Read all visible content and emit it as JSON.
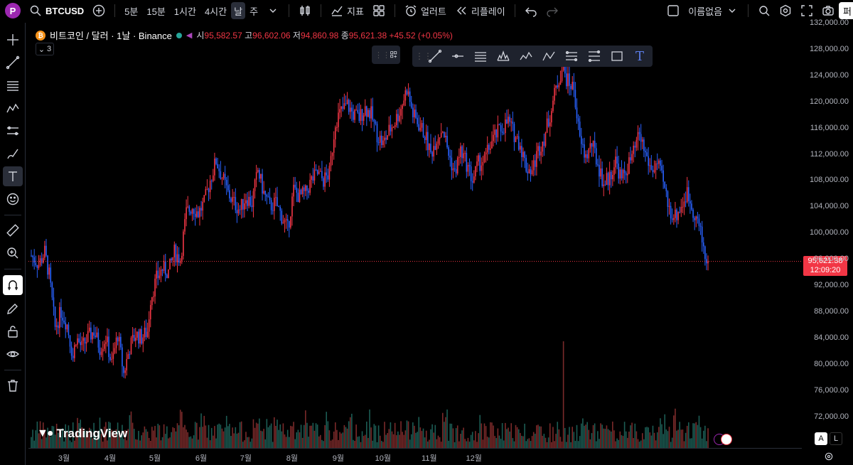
{
  "toolbar": {
    "avatar_letter": "P",
    "symbol": "BTCUSD",
    "intervals": [
      "5분",
      "15분",
      "1시간",
      "4시간",
      "날",
      "주"
    ],
    "active_interval": "날",
    "indicators_label": "지표",
    "alert_label": "얼러트",
    "replay_label": "리플레이",
    "layout_name": "이름없음",
    "cut_label": "퍼"
  },
  "legend": {
    "name": "비트코인 / 달러 · 1날 · Binance",
    "open_label": "시",
    "open": "95,582.57",
    "high_label": "고",
    "high": "96,602.06",
    "low_label": "저",
    "low": "94,860.98",
    "close_label": "종",
    "close": "95,621.38",
    "change": "+45.52 (+0.05%)",
    "collapse_count": "3"
  },
  "watermark": "TradingView",
  "price_tag": {
    "price": "95,621.38",
    "countdown": "12:09:20"
  },
  "bottom_right": {
    "auto_label": "A",
    "log_label": "L"
  },
  "colors": {
    "up": "#f23645",
    "down": "#2962ff",
    "vol_up": "#7a2a2a",
    "vol_down": "#1c5c54",
    "accent": "#2962ff"
  },
  "chart_data": {
    "type": "candlestick",
    "ylim": [
      70000,
      132000
    ],
    "price_ticks": [
      "132,000.00",
      "128,000.00",
      "124,000.00",
      "120,000.00",
      "116,000.00",
      "112,000.00",
      "108,000.00",
      "104,000.00",
      "100,000.00",
      "96,000.00",
      "92,000.00",
      "88,000.00",
      "84,000.00",
      "80,000.00",
      "76,000.00",
      "72,000.00"
    ],
    "months": [
      "3월",
      "4월",
      "5월",
      "6월",
      "7월",
      "8월",
      "9월",
      "10월",
      "11월",
      "12월"
    ],
    "last_price": 95621.38,
    "close_path": [
      [
        0,
        96500
      ],
      [
        5,
        95200
      ],
      [
        9,
        97000
      ],
      [
        12,
        93500
      ],
      [
        16,
        85500
      ],
      [
        20,
        88000
      ],
      [
        24,
        86000
      ],
      [
        28,
        81000
      ],
      [
        30,
        84000
      ],
      [
        34,
        82500
      ],
      [
        38,
        84000
      ],
      [
        42,
        85000
      ],
      [
        46,
        82500
      ],
      [
        50,
        84000
      ],
      [
        54,
        80000
      ],
      [
        58,
        84500
      ],
      [
        62,
        78500
      ],
      [
        66,
        82500
      ],
      [
        70,
        84500
      ],
      [
        74,
        84000
      ],
      [
        78,
        85000
      ],
      [
        80,
        90000
      ],
      [
        84,
        93000
      ],
      [
        88,
        94500
      ],
      [
        92,
        94000
      ],
      [
        96,
        97000
      ],
      [
        100,
        96000
      ],
      [
        104,
        103000
      ],
      [
        108,
        104000
      ],
      [
        112,
        103000
      ],
      [
        116,
        104500
      ],
      [
        120,
        108000
      ],
      [
        124,
        111000
      ],
      [
        128,
        108500
      ],
      [
        132,
        106000
      ],
      [
        136,
        104500
      ],
      [
        140,
        103500
      ],
      [
        144,
        105500
      ],
      [
        148,
        104500
      ],
      [
        152,
        109500
      ],
      [
        156,
        106000
      ],
      [
        160,
        104000
      ],
      [
        164,
        104500
      ],
      [
        168,
        102500
      ],
      [
        172,
        100500
      ],
      [
        176,
        106500
      ],
      [
        180,
        105500
      ],
      [
        184,
        106000
      ],
      [
        188,
        108000
      ],
      [
        192,
        109000
      ],
      [
        196,
        108000
      ],
      [
        200,
        109000
      ],
      [
        204,
        117000
      ],
      [
        208,
        118500
      ],
      [
        212,
        119500
      ],
      [
        216,
        118000
      ],
      [
        220,
        117500
      ],
      [
        224,
        119000
      ],
      [
        228,
        118000
      ],
      [
        232,
        115000
      ],
      [
        236,
        113500
      ],
      [
        240,
        115500
      ],
      [
        244,
        117000
      ],
      [
        248,
        119000
      ],
      [
        252,
        122000
      ],
      [
        256,
        118000
      ],
      [
        260,
        116500
      ],
      [
        264,
        115000
      ],
      [
        268,
        112000
      ],
      [
        272,
        114500
      ],
      [
        276,
        116000
      ],
      [
        280,
        112000
      ],
      [
        284,
        109000
      ],
      [
        288,
        112500
      ],
      [
        292,
        110500
      ],
      [
        296,
        108000
      ],
      [
        300,
        110500
      ],
      [
        304,
        111000
      ],
      [
        308,
        113500
      ],
      [
        312,
        115000
      ],
      [
        316,
        116000
      ],
      [
        320,
        117000
      ],
      [
        324,
        115000
      ],
      [
        328,
        113500
      ],
      [
        332,
        110000
      ],
      [
        336,
        109500
      ],
      [
        340,
        112500
      ],
      [
        344,
        114500
      ],
      [
        348,
        118000
      ],
      [
        352,
        122000
      ],
      [
        356,
        125000
      ],
      [
        360,
        123000
      ],
      [
        364,
        122000
      ],
      [
        368,
        114000
      ],
      [
        372,
        111500
      ],
      [
        376,
        113500
      ],
      [
        380,
        110500
      ],
      [
        384,
        107500
      ],
      [
        388,
        108500
      ],
      [
        392,
        111000
      ],
      [
        396,
        108000
      ],
      [
        400,
        110000
      ],
      [
        404,
        112000
      ],
      [
        408,
        115000
      ],
      [
        412,
        112000
      ],
      [
        416,
        109500
      ],
      [
        420,
        110500
      ],
      [
        424,
        107500
      ],
      [
        428,
        103500
      ],
      [
        432,
        102500
      ],
      [
        436,
        104000
      ],
      [
        440,
        106000
      ],
      [
        444,
        103500
      ],
      [
        448,
        101000
      ],
      [
        452,
        96500
      ],
      [
        454,
        95621
      ]
    ]
  }
}
